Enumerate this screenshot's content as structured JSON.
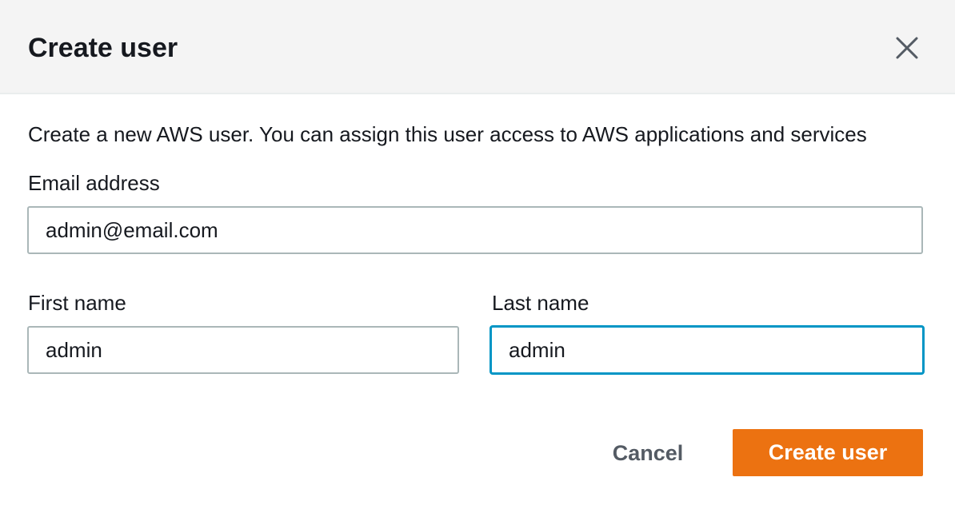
{
  "modal": {
    "title": "Create user",
    "close_icon": "close-icon",
    "description": "Create a new AWS user. You can assign this user access to AWS applications and services"
  },
  "form": {
    "email": {
      "label": "Email address",
      "value": "admin@email.com"
    },
    "first_name": {
      "label": "First name",
      "value": "admin"
    },
    "last_name": {
      "label": "Last name",
      "value": "admin",
      "focused": true
    }
  },
  "actions": {
    "cancel_label": "Cancel",
    "submit_label": "Create user"
  },
  "colors": {
    "primary": "#ec7211",
    "focus": "#0095c5",
    "header_bg": "#f4f4f4",
    "input_border": "#aab7b8",
    "text": "#16191f",
    "cancel_text": "#545b64"
  }
}
